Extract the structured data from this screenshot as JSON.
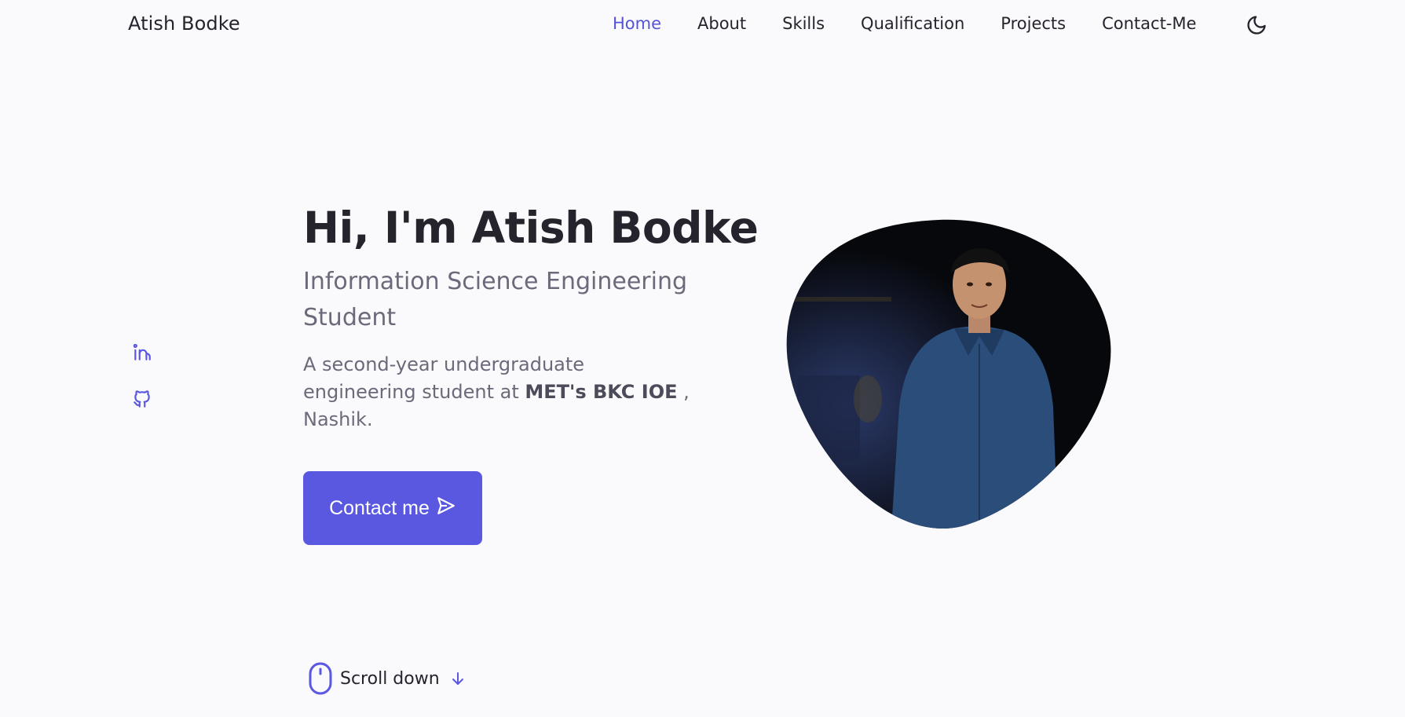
{
  "header": {
    "logo": "Atish Bodke",
    "nav": [
      {
        "label": "Home",
        "active": true
      },
      {
        "label": "About"
      },
      {
        "label": "Skills"
      },
      {
        "label": "Qualification"
      },
      {
        "label": "Projects"
      },
      {
        "label": "Contact-Me"
      }
    ],
    "theme_icon": "moon-icon"
  },
  "social": [
    {
      "icon": "linkedin-icon"
    },
    {
      "icon": "github-icon"
    }
  ],
  "hero": {
    "title": "Hi, I'm Atish Bodke",
    "subtitle": "Information Science Engineering Student",
    "desc_prefix": "A second-year undergraduate engineering student at ",
    "desc_strong": "MET's BKC IOE",
    "desc_suffix": " , Nashik.",
    "button_label": "Contact me",
    "button_icon": "send-icon"
  },
  "scroll": {
    "label": "Scroll down",
    "icon": "mouse-icon",
    "arrow_icon": "arrow-down-icon"
  },
  "colors": {
    "accent": "#5a57e0",
    "text": "#25242d",
    "muted": "#6b6a7a",
    "background": "#faf9fc"
  }
}
